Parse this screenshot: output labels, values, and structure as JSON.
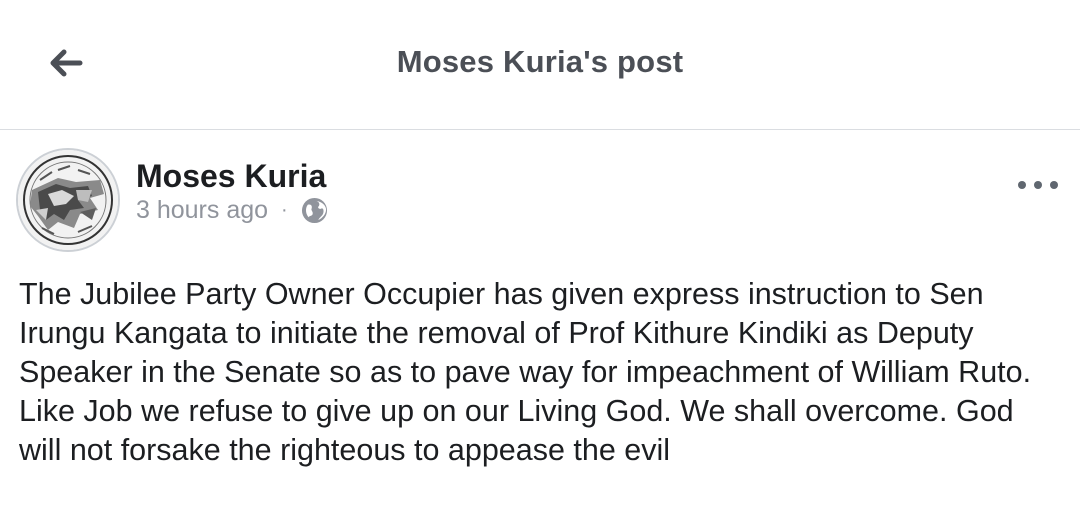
{
  "header": {
    "title": "Moses Kuria's post",
    "back_icon": "arrow-left-icon"
  },
  "post": {
    "author": "Moses Kuria",
    "timestamp": "3 hours ago",
    "separator": "·",
    "privacy_icon": "globe-icon",
    "more_icon": "more-options-icon",
    "text": "The Jubilee Party Owner Occupier has given express instruction to Sen Irungu Kangata to initiate the removal of Prof Kithure Kindiki as Deputy Speaker in the Senate so as to pave way for impeachment of William Ruto. Like Job we refuse to give up on our Living God. We shall overcome. God will not forsake the righteous to appease the evil"
  },
  "colors": {
    "header_text": "#4b4f56",
    "meta_text": "#90949c",
    "body_text": "#1c1e21",
    "divider": "#dadde1"
  }
}
